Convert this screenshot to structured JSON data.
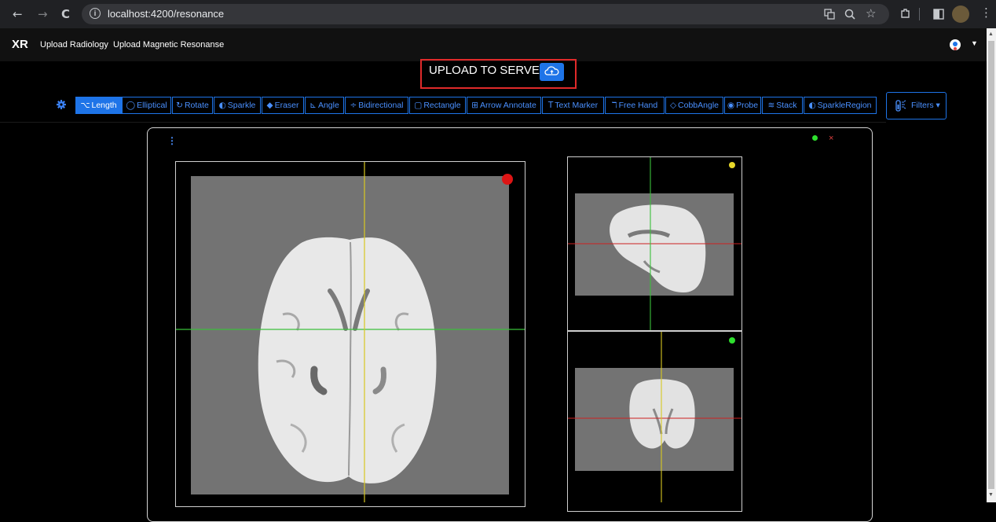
{
  "browser": {
    "url": "localhost:4200/resonance",
    "nav": {
      "back": "←",
      "forward": "→",
      "reload": "C"
    },
    "info": "i"
  },
  "app": {
    "brand": "XR",
    "nav_links": [
      "Upload Radiology",
      "Upload Magnetic Resonanse"
    ]
  },
  "upload": {
    "label": "UPLOAD TO SERVER"
  },
  "toolbar": {
    "tools": [
      {
        "label": "Length",
        "glyph": "⌥",
        "active": true
      },
      {
        "label": "Elliptical",
        "glyph": "◯"
      },
      {
        "label": "Rotate",
        "glyph": "↻"
      },
      {
        "label": "Sparkle",
        "glyph": "◐"
      },
      {
        "label": "Eraser",
        "glyph": "◆"
      },
      {
        "label": "Angle",
        "glyph": "⊾"
      },
      {
        "label": "Bidirectional",
        "glyph": "÷"
      },
      {
        "label": "Rectangle",
        "glyph": "▢"
      },
      {
        "label": "Arrow Annotate",
        "glyph": "⊞"
      },
      {
        "label": "Text Marker",
        "glyph": "T"
      },
      {
        "label": "Free Hand",
        "glyph": "ℸ"
      },
      {
        "label": "CobbAngle",
        "glyph": "◇"
      },
      {
        "label": "Probe",
        "glyph": "◉"
      },
      {
        "label": "Stack",
        "glyph": "≋"
      },
      {
        "label": "SparkleRegion",
        "glyph": "◐"
      }
    ],
    "filters_label": "Filters"
  },
  "viewer": {
    "menu_glyph": "⋮",
    "close_glyph": "×"
  },
  "colors": {
    "accent": "#1e74e8",
    "highlight_box": "#e02a2a",
    "crosshair_green": "#3bbf3b",
    "crosshair_yellow": "#d8c820",
    "crosshair_red": "#cc2020",
    "marker_red": "#dd1515",
    "marker_yellow": "#e8d82a",
    "marker_green": "#2ee02e"
  },
  "icons": [
    "back-icon",
    "forward-icon",
    "reload-icon",
    "info-icon",
    "translate-icon",
    "zoom-icon",
    "star-icon",
    "extensions-icon",
    "sidepanel-icon",
    "profile-avatar-icon",
    "kebab-menu-icon",
    "gear-icon",
    "cloud-upload-icon",
    "filters-icon",
    "more-vert-icon",
    "close-icon"
  ]
}
